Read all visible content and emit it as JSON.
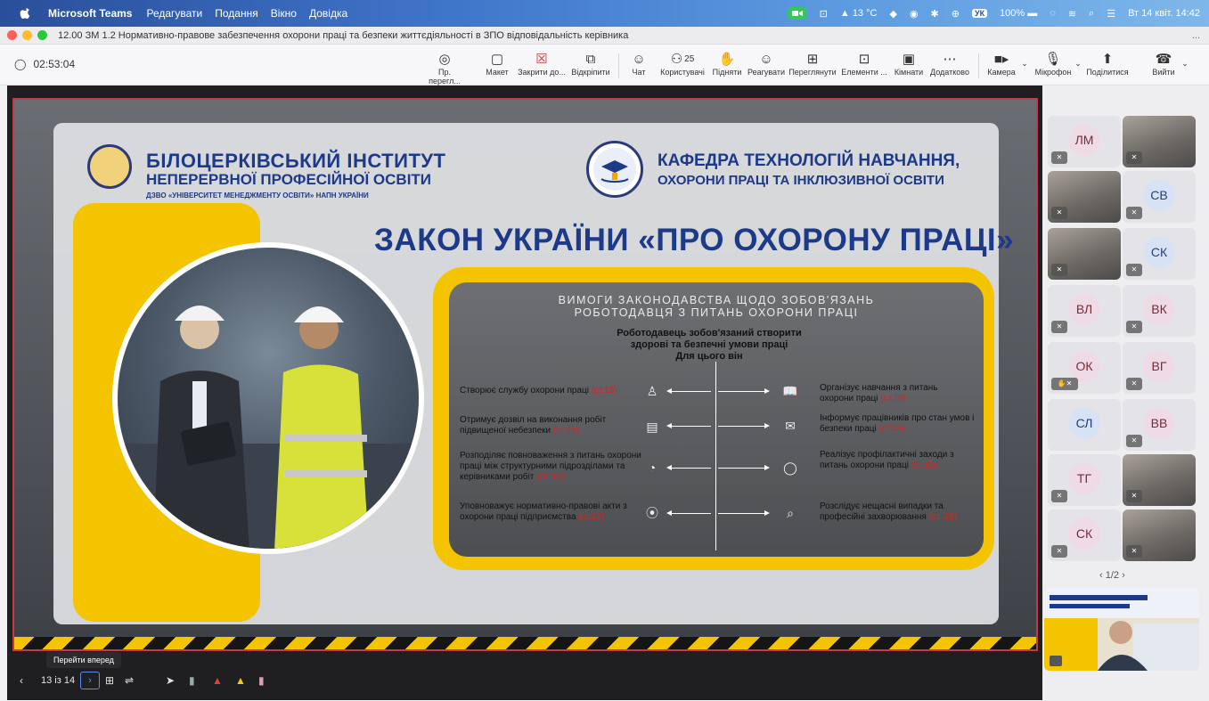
{
  "menubar": {
    "app_name": "Microsoft Teams",
    "menus": [
      "Редагувати",
      "Подання",
      "Вікно",
      "Довідка"
    ],
    "weather": "13 °C",
    "keyboard": "УК",
    "battery": "100%",
    "datetime": "Вт 14 квіт. 14:42"
  },
  "window": {
    "title": "12.00 ЗМ 1.2 Нормативно-правове забезпечення охорони праці та безпеки життєдіяльності в ЗПО відповідальність керівника",
    "more": "..."
  },
  "toolbar": {
    "timer": "02:53:04",
    "items": [
      {
        "label": "Пр. перегл..."
      },
      {
        "label": "Макет"
      },
      {
        "label": "Закрити до..."
      },
      {
        "label": "Відкріпити"
      },
      {
        "label": "Чат"
      },
      {
        "label": "Користувачі",
        "count": "25"
      },
      {
        "label": "Підняти"
      },
      {
        "label": "Реагувати"
      },
      {
        "label": "Переглянути"
      },
      {
        "label": "Елементи ..."
      },
      {
        "label": "Кімнати"
      },
      {
        "label": "Додатково"
      },
      {
        "label": "Камера"
      },
      {
        "label": "Мікрофон"
      },
      {
        "label": "Поділитися"
      },
      {
        "label": "Вийти"
      }
    ]
  },
  "slide": {
    "institute_line1": "БІЛОЦЕРКІВСЬКИЙ ІНСТИТУТ",
    "institute_line2": "НЕПЕРЕРВНОЇ ПРОФЕСІЙНОЇ ОСВІТИ",
    "institute_line3": "ДЗВО «УНІВЕРСИТЕТ МЕНЕДЖМЕНТУ ОСВІТИ» НАПН УКРАЇНИ",
    "dept_line1": "КАФЕДРА ТЕХНОЛОГІЙ НАВЧАННЯ,",
    "dept_line2": "ОХОРОНИ ПРАЦІ ТА ІНКЛЮЗИВНОЇ ОСВІТИ",
    "law_title": "ЗАКОН УКРАЇНИ «ПРО ОХОРОНУ ПРАЦІ»",
    "req_line1": "ВИМОГИ ЗАКОНОДАВСТВА ЩОДО ЗОБОВ'ЯЗАНЬ",
    "req_line2": "РОБОТОДАВЦЯ З ПИТАНЬ ОХОРОНИ ПРАЦІ",
    "emp_line1": "Роботодавець зобов'язаний створити",
    "emp_line2": "здорові та безпечні умови праці",
    "emp_line3": "Для цього він",
    "left_items": [
      {
        "text": "Створює службу охорони праці ",
        "ref": "(ст.15)"
      },
      {
        "text": "Отримує дозвіл на виконання робіт підвищеної небезпеки ",
        "ref": "(ст.21)"
      },
      {
        "text": "Розподіляє повноваження з питань охорони праці між структурними підрозділами та керівниками робіт ",
        "ref": "(ст. 13)"
      },
      {
        "text": "Уповноважує нормативно-правові акти з охорони праці підприємства ",
        "ref": "(ст.13)"
      }
    ],
    "right_items": [
      {
        "text": "Організує навчання з питань охорони праці ",
        "ref": "(ст.18)"
      },
      {
        "text": "Інформує працівників про стан умов і безпеки праці ",
        "ref": "(ст.23)."
      },
      {
        "text": "Реалізує профілактичні заходи з питань охорони праці ",
        "ref": "(ст.19)"
      },
      {
        "text": "Розслідує нещасні випадки та професійні захворювання ",
        "ref": "(ст. 22)"
      }
    ]
  },
  "controls": {
    "tooltip": "Перейти вперед",
    "page": "13 із 14"
  },
  "participants": {
    "tiles": [
      {
        "initials": "ЛМ"
      },
      {
        "initials": ""
      },
      {
        "initials": ""
      },
      {
        "initials": "СВ"
      },
      {
        "initials": ""
      },
      {
        "initials": "СК"
      },
      {
        "initials": "ВЛ"
      },
      {
        "initials": "ВК"
      },
      {
        "initials": "ОК"
      },
      {
        "initials": "ВГ"
      },
      {
        "initials": "СЛ"
      },
      {
        "initials": "ВВ"
      },
      {
        "initials": "ТГ"
      },
      {
        "initials": ""
      },
      {
        "initials": "СК"
      },
      {
        "initials": ""
      }
    ],
    "pager": "1/2"
  }
}
